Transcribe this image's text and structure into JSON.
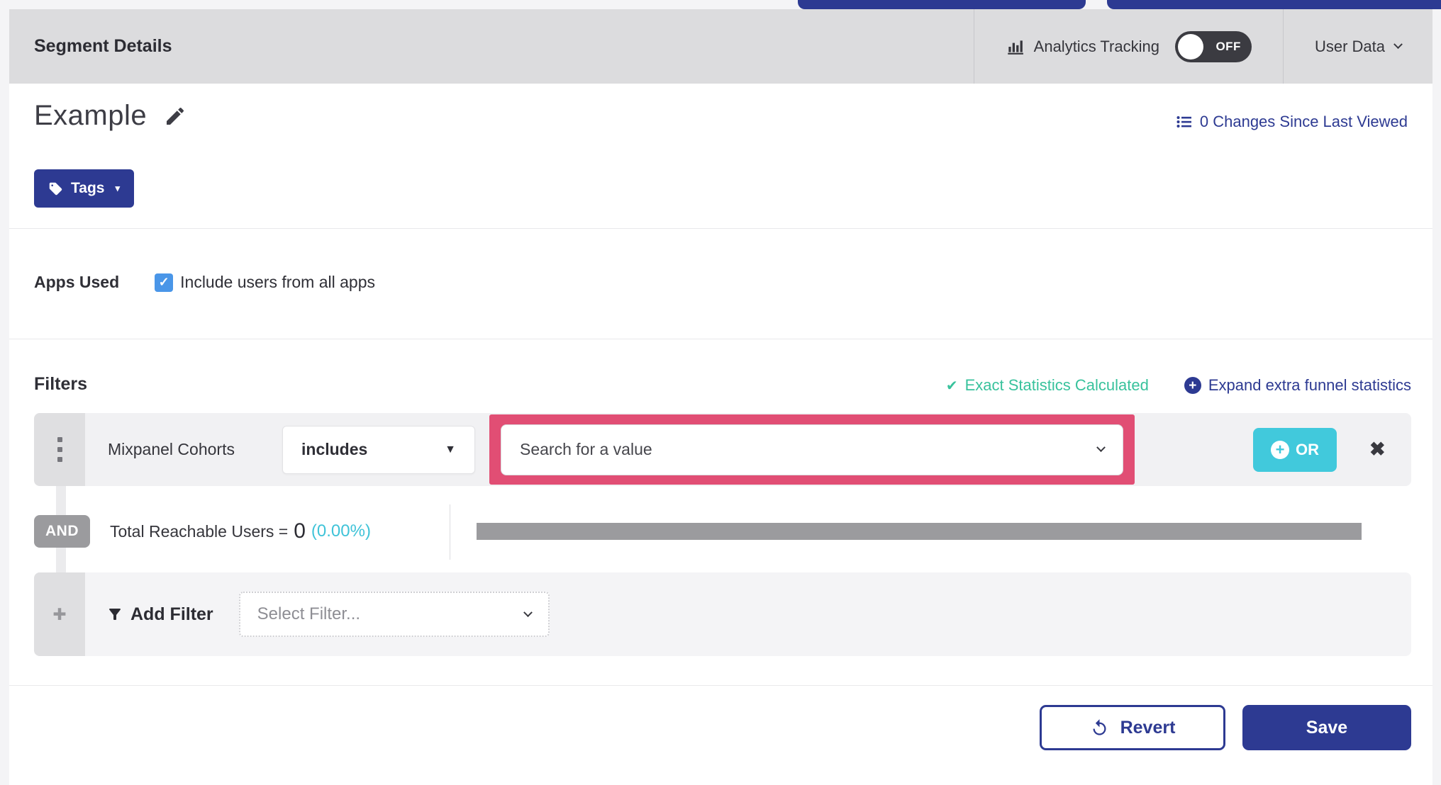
{
  "header": {
    "title": "Segment Details",
    "analytics_tracking_label": "Analytics Tracking",
    "toggle_state": "OFF",
    "user_data_label": "User Data"
  },
  "segment": {
    "name": "Example",
    "tags_button_label": "Tags",
    "changes_link_label": "0 Changes Since Last Viewed"
  },
  "apps_used": {
    "label": "Apps Used",
    "checkbox_checked": true,
    "checkbox_label": "Include users from all apps"
  },
  "filters": {
    "title": "Filters",
    "exact_stats_label": "Exact Statistics Calculated",
    "expand_link_label": "Expand extra funnel statistics",
    "filter_row": {
      "field": "Mixpanel Cohorts",
      "operator": "includes",
      "value_placeholder": "Search for a value",
      "or_button_label": "OR"
    },
    "and_label": "AND",
    "total_reachable": {
      "label": "Total Reachable Users =",
      "value": "0",
      "percent": "(0.00%)"
    },
    "add_filter": {
      "label": "Add Filter",
      "select_placeholder": "Select Filter..."
    }
  },
  "footer": {
    "revert_label": "Revert",
    "save_label": "Save"
  },
  "icons": {
    "checkbox_check": "✓",
    "exact_check": "✔",
    "plus": "+",
    "add_plus": "✚",
    "close": "✖",
    "op_caret": "▼",
    "tags_caret": "▾"
  },
  "colors": {
    "navy": "#2d3a92",
    "cyan": "#41c9dc",
    "teal": "#38c29c",
    "pink_highlight": "#e14e74",
    "checkbox_blue": "#4a96e8",
    "header_gray": "#dcdcde",
    "bar_gray": "#9b9b9e"
  }
}
